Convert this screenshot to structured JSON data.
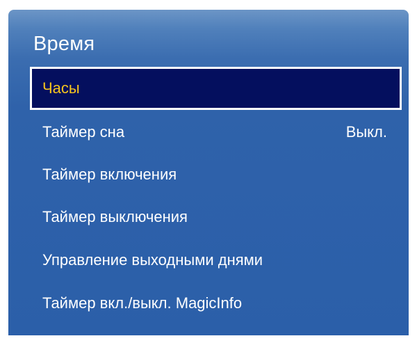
{
  "panel": {
    "title": "Время"
  },
  "menu": {
    "items": [
      {
        "label": "Часы",
        "value": "",
        "selected": true
      },
      {
        "label": "Таймер сна",
        "value": "Выкл.",
        "selected": false
      },
      {
        "label": "Таймер включения",
        "value": "",
        "selected": false
      },
      {
        "label": "Таймер выключения",
        "value": "",
        "selected": false
      },
      {
        "label": "Управление выходными днями",
        "value": "",
        "selected": false
      },
      {
        "label": "Таймер вкл./выкл. MagicInfo",
        "value": "",
        "selected": false
      }
    ]
  },
  "colors": {
    "panel_top": "#6c95c6",
    "panel_body": "#2b5fa9",
    "selected_bg": "#040f5e",
    "selected_border": "#ffffff",
    "selected_text": "#f6c51d",
    "text": "#ffffff"
  }
}
